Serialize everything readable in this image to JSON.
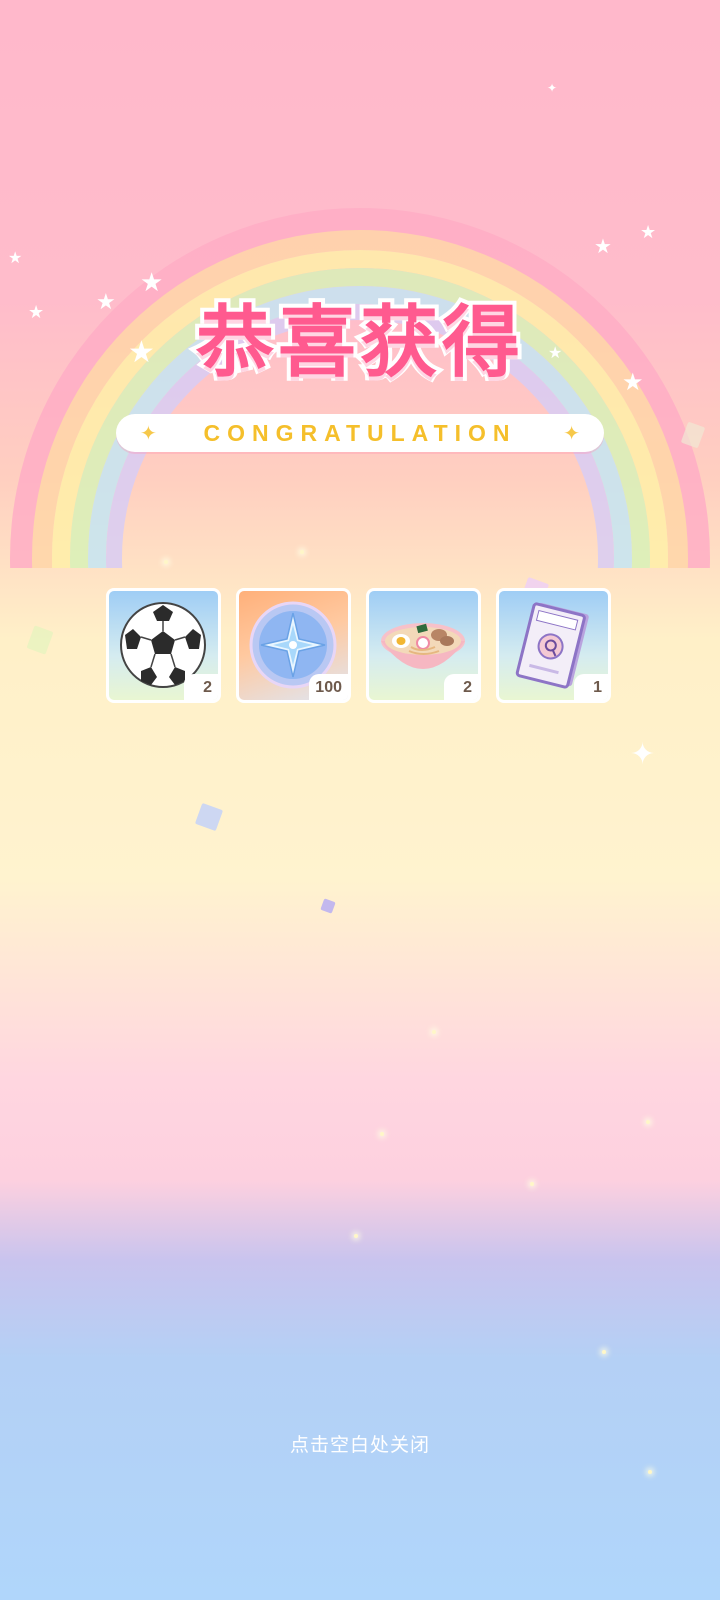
{
  "popup": {
    "title": "恭喜获得",
    "subtitle": "CONGRATULATION",
    "close_hint": "点击空白处关闭"
  },
  "rewards": [
    {
      "name": "soccer-ball",
      "icon": "soccer-ball-icon",
      "quantity": "2"
    },
    {
      "name": "star-crystal-coin",
      "icon": "star-coin-icon",
      "quantity": "100"
    },
    {
      "name": "ramen-bowl",
      "icon": "ramen-icon",
      "quantity": "2"
    },
    {
      "name": "detective-book",
      "icon": "book-icon",
      "quantity": "1"
    }
  ],
  "colors": {
    "title": "#ff5a8f",
    "subtitle": "#f5bf2b",
    "quantity_text": "#6e5a4c",
    "background_top": "#ffb8cb",
    "background_bottom": "#b0d6fb"
  }
}
